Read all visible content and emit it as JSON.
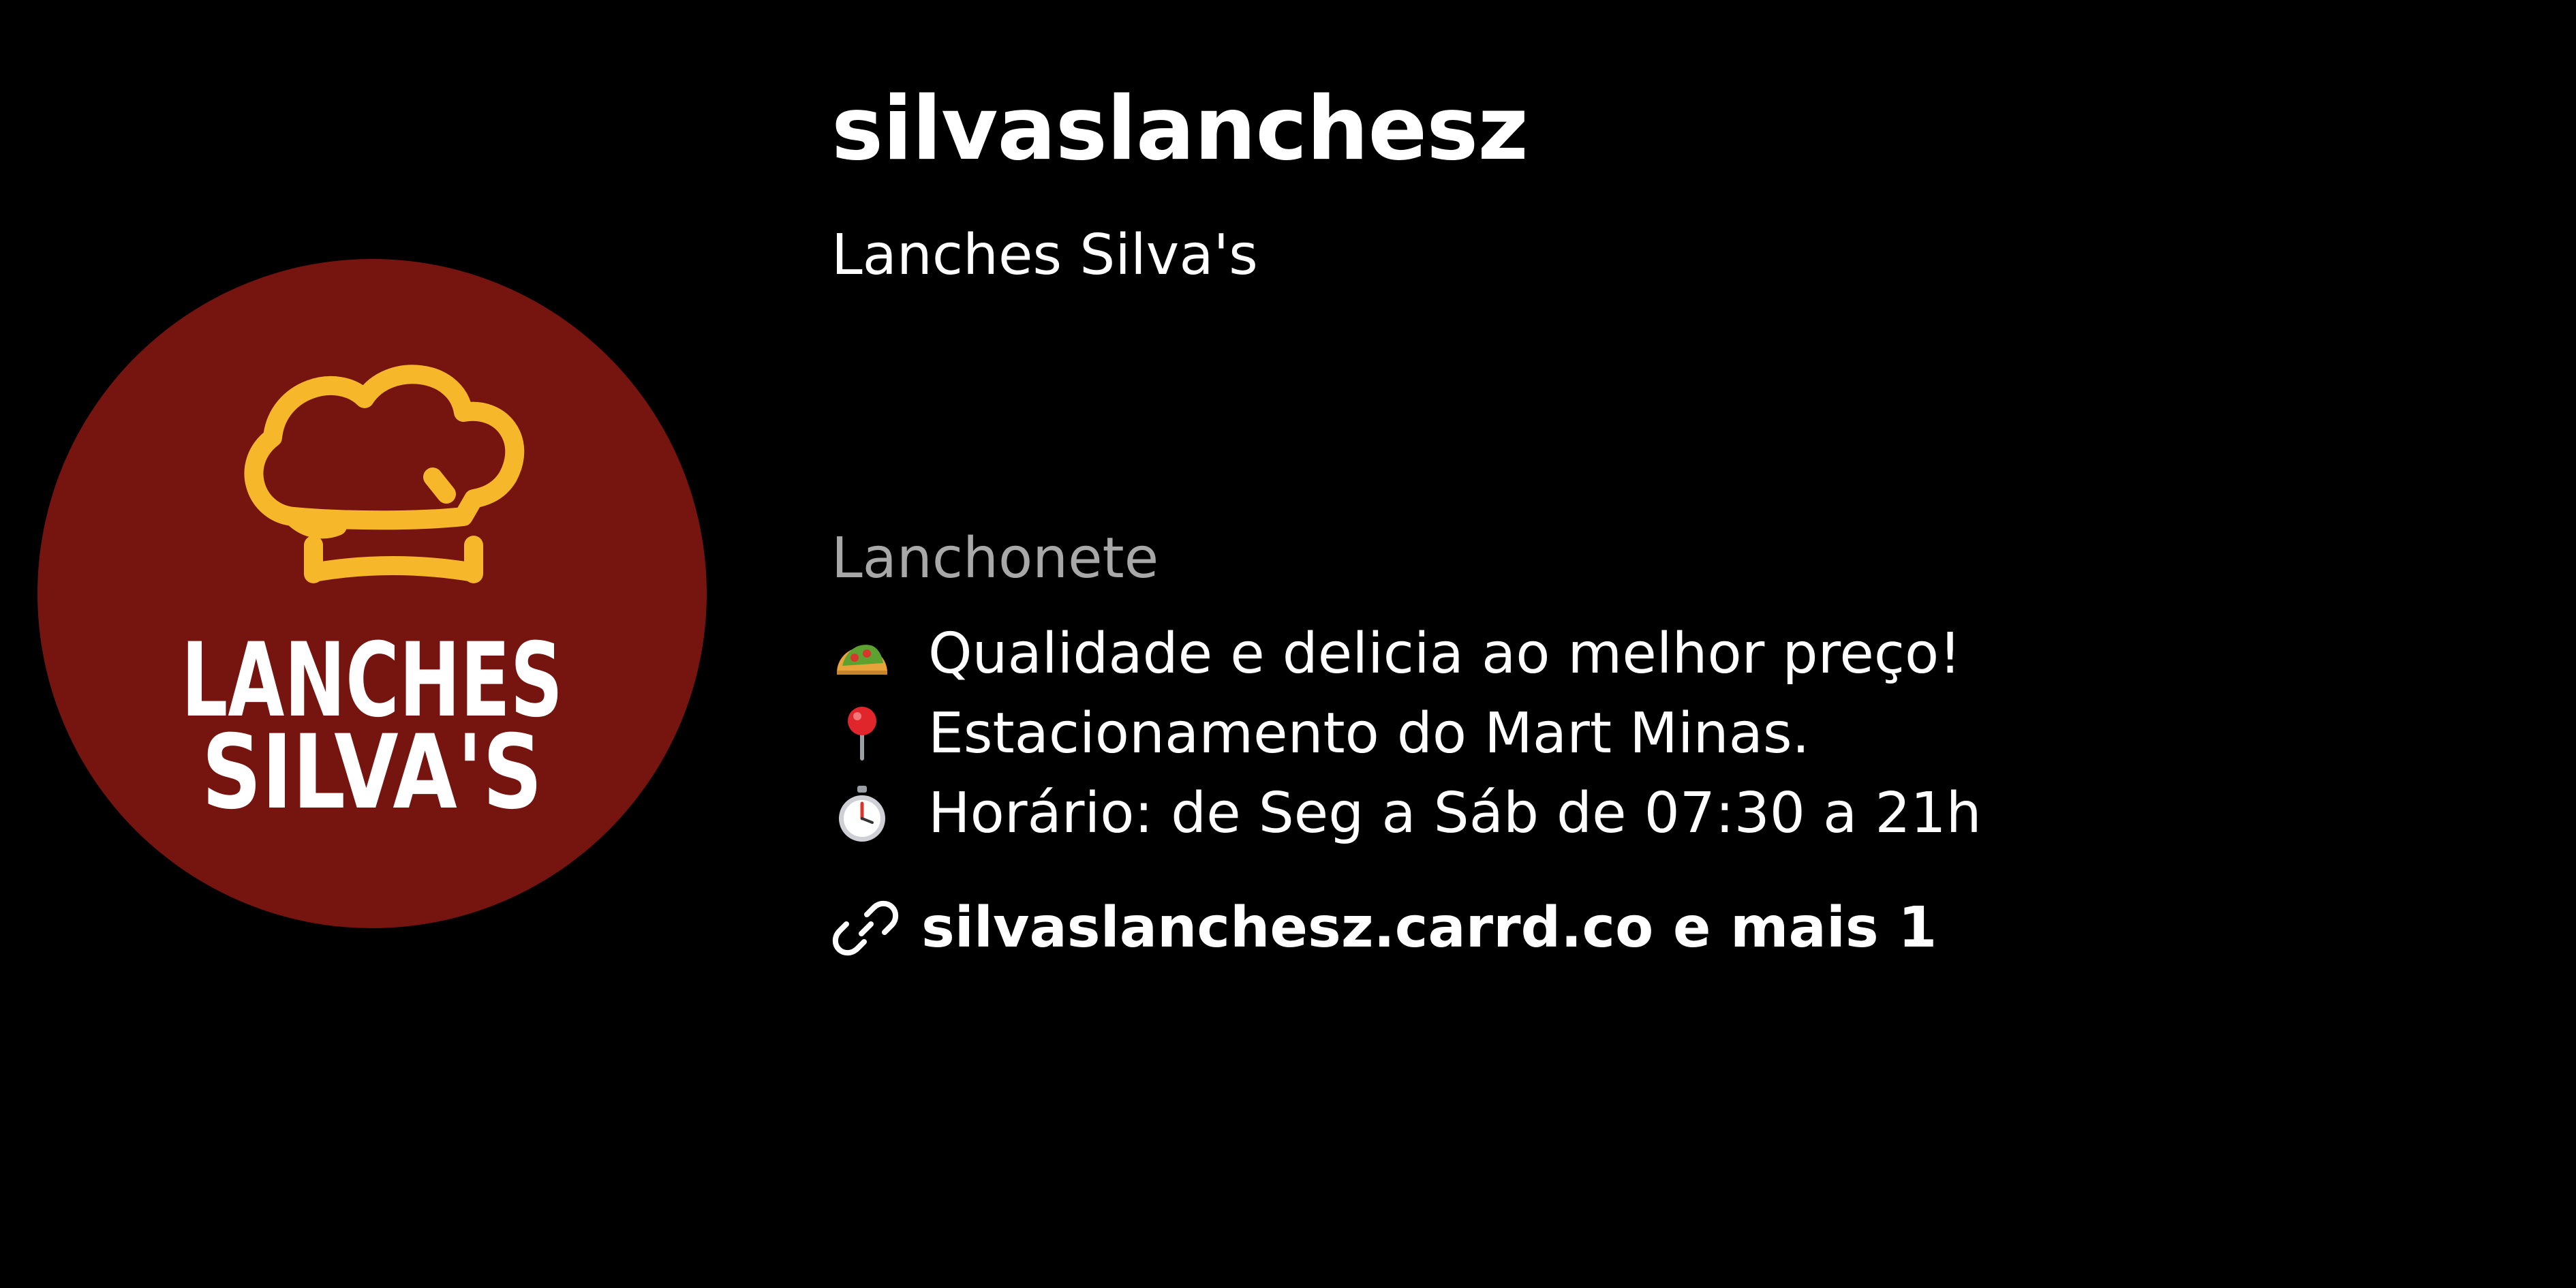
{
  "profile": {
    "username": "silvaslanchesz",
    "full_name": "Lanches Silva's",
    "category": "Lanchonete",
    "avatar": {
      "logo_line1": "LANCHES",
      "logo_line2": "SILVA'S",
      "icon": "chef-hat-icon",
      "background_color": "#761510",
      "hat_color": "#F6B72A",
      "text_color": "#FFFFFF"
    },
    "bio": [
      {
        "icon": "taco-icon",
        "text": "Qualidade e delicia ao melhor preço!"
      },
      {
        "icon": "round-pushpin-icon",
        "text": "Estacionamento do Mart Minas."
      },
      {
        "icon": "stopwatch-icon",
        "text": "Horário: de Seg a Sáb de 07:30 a 21h"
      }
    ],
    "link": {
      "icon": "link-icon",
      "text": "silvaslanchesz.carrd.co e mais 1"
    }
  }
}
